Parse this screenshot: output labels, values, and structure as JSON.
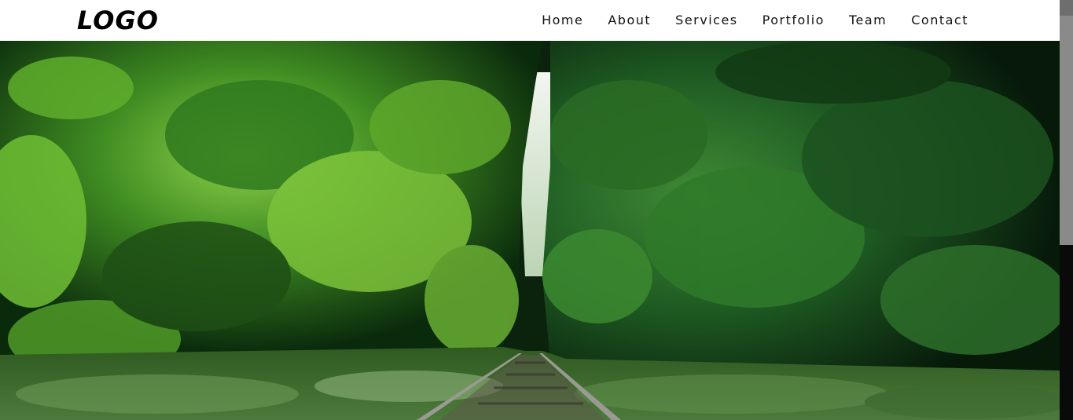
{
  "header": {
    "logo_text": "LOGO",
    "nav": [
      "Home",
      "About",
      "Services",
      "Portfolio",
      "Team",
      "Contact"
    ]
  },
  "hero": {
    "image_alt": "",
    "colors": {
      "canopy_dark": "#0b2410",
      "canopy_mid": "#2f6b1e",
      "canopy_light": "#7cc23a",
      "sky": "#e8f0e6",
      "rail": "#8c8c86",
      "ground": "#3b5f2a"
    }
  },
  "scrollbar": {
    "icon": "scroll-thumb"
  }
}
